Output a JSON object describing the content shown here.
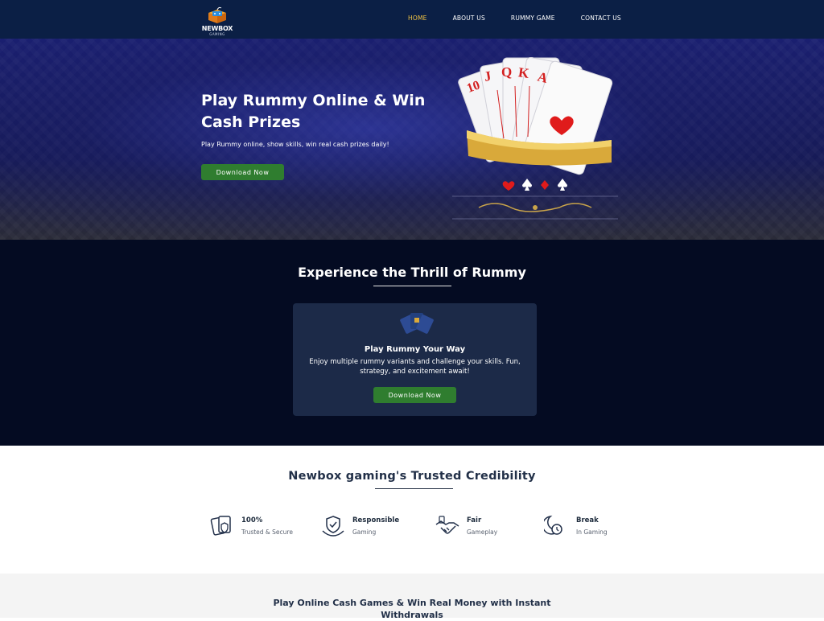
{
  "nav": {
    "logo_text": "NEWBOX",
    "logo_sub": "GAMING",
    "links": [
      "HOME",
      "ABOUT US",
      "RUMMY GAME",
      "CONTACT US"
    ],
    "active_color": "#f3c443"
  },
  "hero": {
    "title": "Play Rummy Online & Win Cash Prizes",
    "subtitle": "Play Rummy online, show skills, win real cash prizes daily!",
    "button_label": "Download Now",
    "art_icon": "royal-flush-cards-icon"
  },
  "experience": {
    "title": "Experience the Thrill of Rummy",
    "card_title": "Play Rummy Your Way",
    "card_text": "Enjoy multiple rummy variants and challenge your skills. Fun, strategy, and excitement await!",
    "button_label": "Download Now"
  },
  "trust": {
    "title": "Newbox gaming's Trusted Credibility",
    "features": [
      {
        "title": "100%",
        "subtitle": "Trusted & Secure",
        "icon": "cards-shield-icon"
      },
      {
        "title": "Responsible",
        "subtitle": "Gaming",
        "icon": "hand-shield-icon"
      },
      {
        "title": "Fair",
        "subtitle": "Gameplay",
        "icon": "handshake-icon"
      },
      {
        "title": "Break",
        "subtitle": "In Gaming",
        "icon": "moon-clock-icon"
      }
    ]
  },
  "bottom": {
    "title": "Play Online Cash Games & Win Real Money with Instant Withdrawals"
  },
  "colors": {
    "nav_bg": "#0b1f45",
    "dark_bg": "#040b22",
    "card_bg": "#1c2a48",
    "button_green": "#2f7d2f",
    "accent_gold": "#f3c443"
  }
}
